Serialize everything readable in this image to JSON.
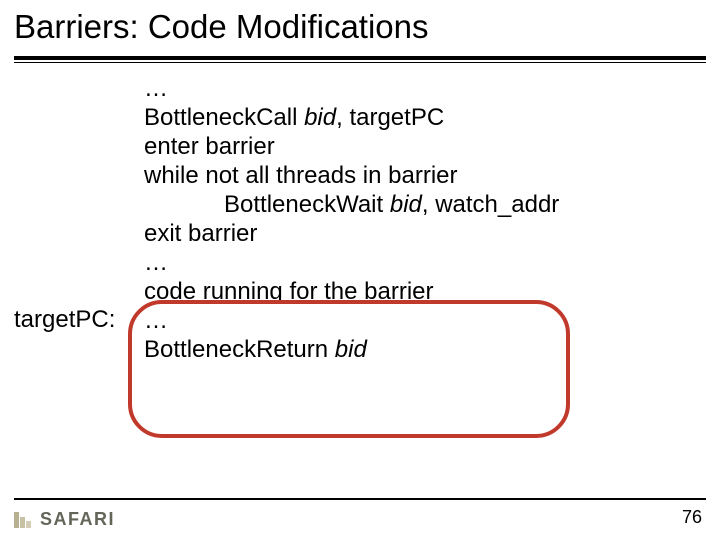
{
  "title": "Barriers: Code Modifications",
  "label": "targetPC:",
  "code": {
    "l0": "…",
    "l1a": "BottleneckCall ",
    "l1b": "bid",
    "l1c": ", targetPC",
    "l2": "enter barrier",
    "l3": "while not all threads in barrier",
    "l4a": "BottleneckWait ",
    "l4b": "bid",
    "l4c": ", watch_addr",
    "l5": "exit barrier",
    "l6": "…",
    "l7": "code running for the barrier",
    "l8": "…",
    "l9a": "BottleneckReturn ",
    "l9b": "bid"
  },
  "logo": "SAFARI",
  "page": "76"
}
